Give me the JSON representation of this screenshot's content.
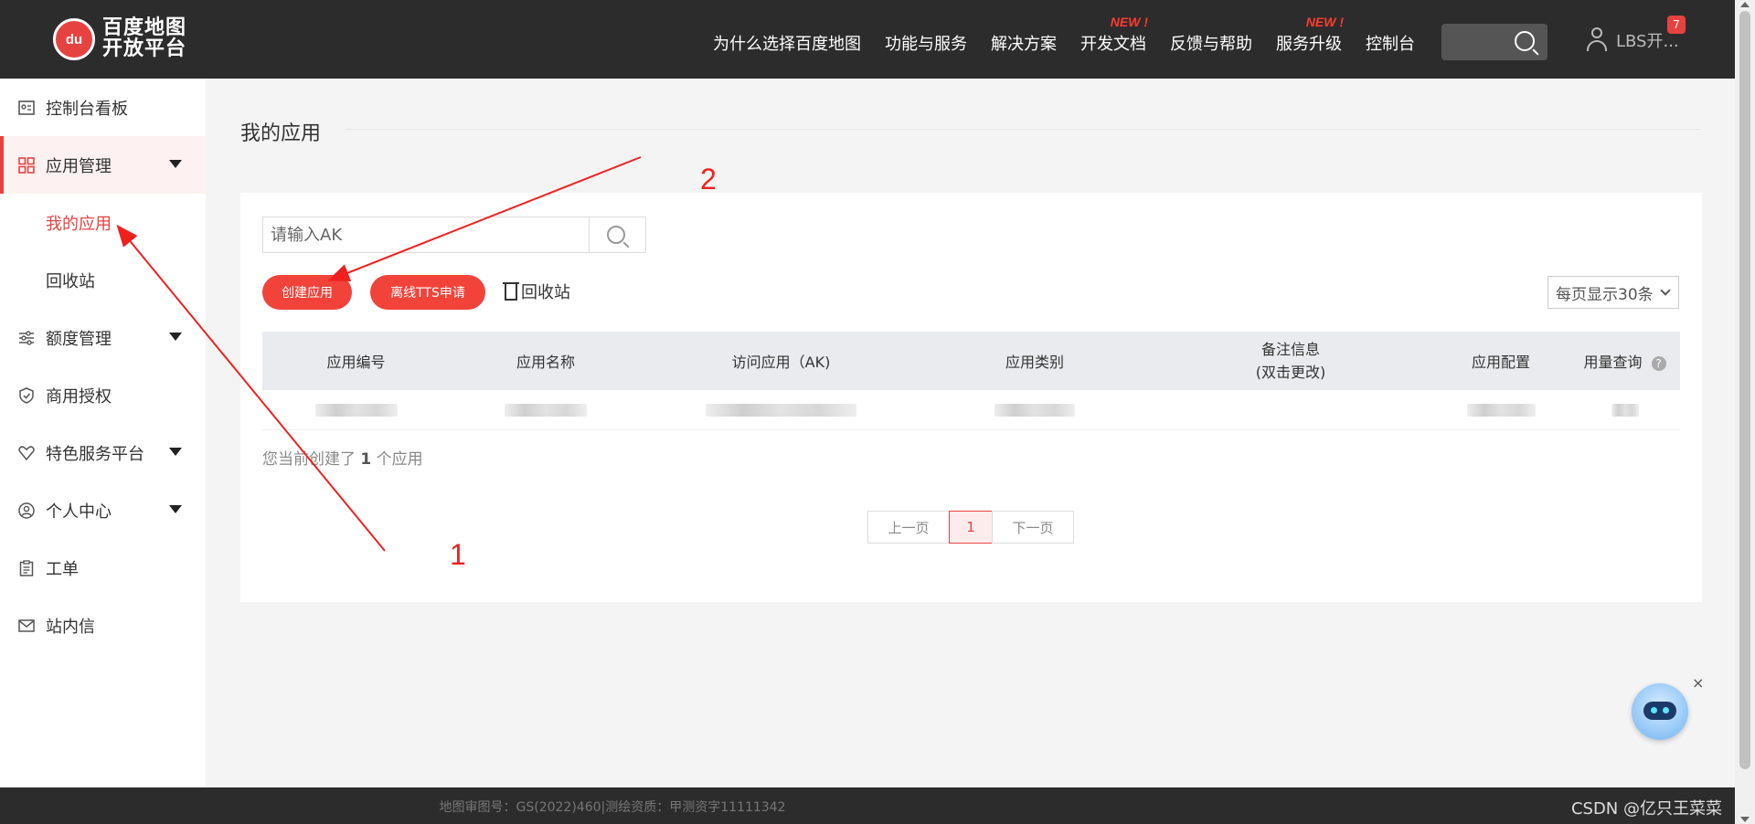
{
  "header": {
    "logo_badge": "du",
    "logo_line1": "百度地图",
    "logo_line2": "开放平台",
    "nav": [
      {
        "label": "为什么选择百度地图",
        "badge": ""
      },
      {
        "label": "功能与服务",
        "badge": ""
      },
      {
        "label": "解决方案",
        "badge": ""
      },
      {
        "label": "开发文档",
        "badge": "NEW !"
      },
      {
        "label": "反馈与帮助",
        "badge": ""
      },
      {
        "label": "服务升级",
        "badge": "NEW !"
      },
      {
        "label": "控制台",
        "badge": ""
      }
    ],
    "user_name": "LBS开...",
    "notification_count": "7"
  },
  "sidebar": {
    "items": [
      {
        "label": "控制台看板",
        "icon": "dashboard-icon"
      },
      {
        "label": "应用管理",
        "icon": "grid-icon",
        "expanded": true
      },
      {
        "label": "我的应用",
        "sub": true,
        "active": true
      },
      {
        "label": "回收站",
        "sub": true
      },
      {
        "label": "额度管理",
        "icon": "sliders-icon"
      },
      {
        "label": "商用授权",
        "icon": "shield-check-icon"
      },
      {
        "label": "特色服务平台",
        "icon": "heart-tag-icon"
      },
      {
        "label": "个人中心",
        "icon": "user-circle-icon"
      },
      {
        "label": "工单",
        "icon": "clipboard-icon"
      },
      {
        "label": "站内信",
        "icon": "mail-icon"
      }
    ]
  },
  "main": {
    "title": "我的应用",
    "search_placeholder": "请输入AK",
    "create_button": "创建应用",
    "tts_button": "离线TTS申请",
    "recycle_link": "回收站",
    "per_page": "每页显示30条",
    "table_headers": [
      "应用编号",
      "应用名称",
      "访问应用（AK)",
      "应用类别",
      "备注信息",
      "(双击更改)",
      "应用配置",
      "用量查询"
    ],
    "help_glyph": "?",
    "count_prefix": "您当前创建了",
    "count_value": "1",
    "count_suffix": "个应用",
    "pager": {
      "prev": "上一页",
      "current": "1",
      "next": "下一页"
    }
  },
  "annotations": {
    "label_1": "1",
    "label_2": "2",
    "color": "#f02020"
  },
  "footer": {
    "icp": "地图审图号：GS(2022)460|测绘资质：甲测资字11111342",
    "watermark": "CSDN @亿只王菜菜"
  },
  "robot_close": "×",
  "colors": {
    "brand_red": "#e64340",
    "button_red": "#f2433a",
    "topbar": "#2c2c2c"
  }
}
